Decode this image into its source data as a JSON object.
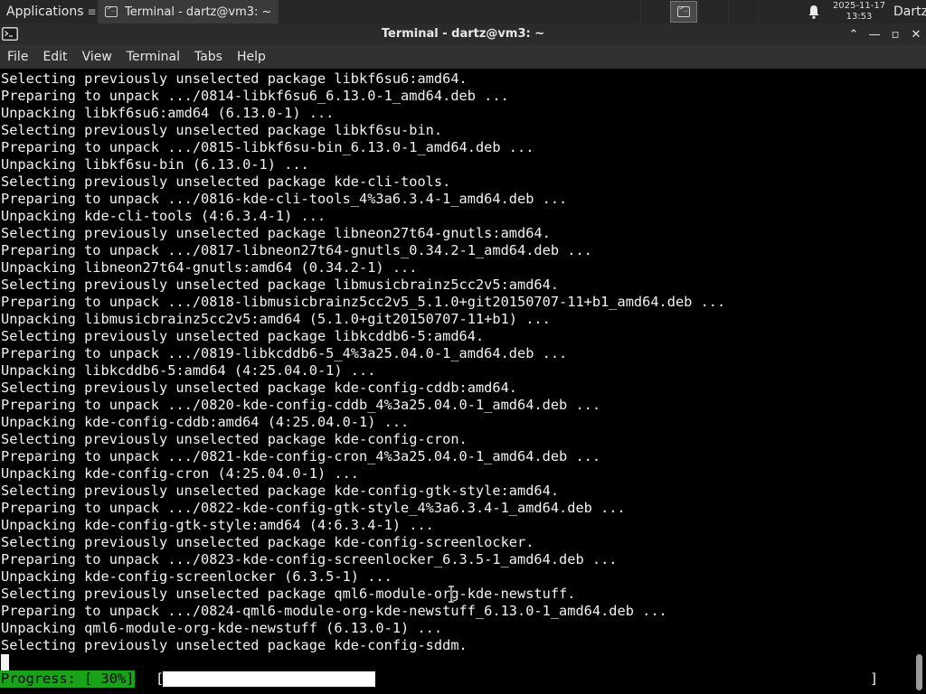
{
  "panel": {
    "applications_label": "Applications",
    "task_title": "Terminal - dartz@vm3: ~",
    "clock_date": "2025-11-17",
    "clock_time": "13:53",
    "user": "Dartz",
    "icons": [
      "xfce-logo-icon",
      "terminal-icon",
      "bell-icon"
    ]
  },
  "window": {
    "title": "Terminal - dartz@vm3: ~",
    "buttons": {
      "maximize_symbol": "⌃",
      "minimize_symbol": "—",
      "restore_symbol": "▫",
      "close_symbol": "✕"
    }
  },
  "menubar": {
    "items": [
      "File",
      "Edit",
      "View",
      "Terminal",
      "Tabs",
      "Help"
    ]
  },
  "terminal": {
    "lines": [
      "Selecting previously unselected package libkf6su6:amd64.",
      "Preparing to unpack .../0814-libkf6su6_6.13.0-1_amd64.deb ...",
      "Unpacking libkf6su6:amd64 (6.13.0-1) ...",
      "Selecting previously unselected package libkf6su-bin.",
      "Preparing to unpack .../0815-libkf6su-bin_6.13.0-1_amd64.deb ...",
      "Unpacking libkf6su-bin (6.13.0-1) ...",
      "Selecting previously unselected package kde-cli-tools.",
      "Preparing to unpack .../0816-kde-cli-tools_4%3a6.3.4-1_amd64.deb ...",
      "Unpacking kde-cli-tools (4:6.3.4-1) ...",
      "Selecting previously unselected package libneon27t64-gnutls:amd64.",
      "Preparing to unpack .../0817-libneon27t64-gnutls_0.34.2-1_amd64.deb ...",
      "Unpacking libneon27t64-gnutls:amd64 (0.34.2-1) ...",
      "Selecting previously unselected package libmusicbrainz5cc2v5:amd64.",
      "Preparing to unpack .../0818-libmusicbrainz5cc2v5_5.1.0+git20150707-11+b1_amd64.deb ...",
      "Unpacking libmusicbrainz5cc2v5:amd64 (5.1.0+git20150707-11+b1) ...",
      "Selecting previously unselected package libkcddb6-5:amd64.",
      "Preparing to unpack .../0819-libkcddb6-5_4%3a25.04.0-1_amd64.deb ...",
      "Unpacking libkcddb6-5:amd64 (4:25.04.0-1) ...",
      "Selecting previously unselected package kde-config-cddb:amd64.",
      "Preparing to unpack .../0820-kde-config-cddb_4%3a25.04.0-1_amd64.deb ...",
      "Unpacking kde-config-cddb:amd64 (4:25.04.0-1) ...",
      "Selecting previously unselected package kde-config-cron.",
      "Preparing to unpack .../0821-kde-config-cron_4%3a25.04.0-1_amd64.deb ...",
      "Unpacking kde-config-cron (4:25.04.0-1) ...",
      "Selecting previously unselected package kde-config-gtk-style:amd64.",
      "Preparing to unpack .../0822-kde-config-gtk-style_4%3a6.3.4-1_amd64.deb ...",
      "Unpacking kde-config-gtk-style:amd64 (4:6.3.4-1) ...",
      "Selecting previously unselected package kde-config-screenlocker.",
      "Preparing to unpack .../0823-kde-config-screenlocker_6.3.5-1_amd64.deb ...",
      "Unpacking kde-config-screenlocker (6.3.5-1) ...",
      "Selecting previously unselected package qml6-module-org-kde-newstuff.",
      "Preparing to unpack .../0824-qml6-module-org-kde-newstuff_6.13.0-1_amd64.deb ...",
      "Unpacking qml6-module-org-kde-newstuff (6.13.0-1) ...",
      "Selecting previously unselected package kde-config-sddm."
    ],
    "progress_label": "Progress: [ 30%]",
    "progress_bracket_open": "[",
    "progress_bracket_close": "]",
    "progress_fraction": 0.3,
    "progress_color": "#1aa31a"
  }
}
